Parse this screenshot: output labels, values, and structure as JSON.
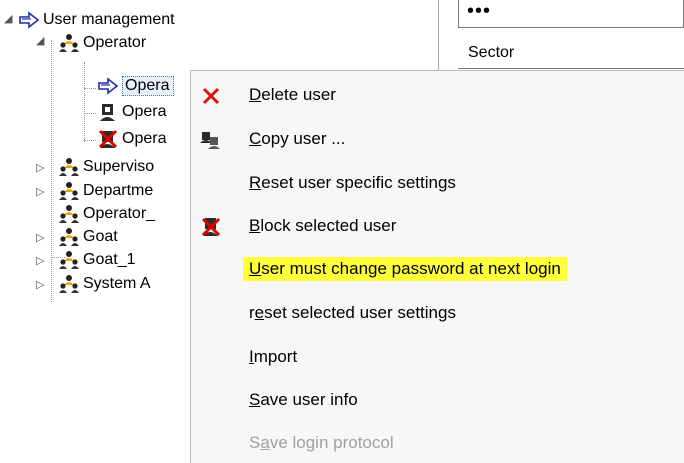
{
  "tree": {
    "root": {
      "label": "User management",
      "icon": "arrow-icon"
    },
    "operator": {
      "label": "Operator"
    },
    "children": [
      {
        "label": "Opera",
        "icon": "arrow-user-icon"
      },
      {
        "label": "Opera",
        "icon": "person-icon"
      },
      {
        "label": "Opera",
        "icon": "blocked-user-icon"
      }
    ],
    "groups": [
      {
        "label": "Superviso",
        "expander": "▷"
      },
      {
        "label": "Departme",
        "expander": "▷"
      },
      {
        "label": "Operator_",
        "expander": ""
      },
      {
        "label": "Goat",
        "expander": "▷"
      },
      {
        "label": "Goat_1",
        "expander": "▷"
      },
      {
        "label": "System A",
        "expander": "▷"
      }
    ]
  },
  "form": {
    "password_mask": "•••",
    "sector_label": "Sector"
  },
  "context_menu": {
    "items": [
      {
        "pre": "",
        "u": "D",
        "post": "elete user",
        "icon": "red-x-icon",
        "state": "normal"
      },
      {
        "pre": "",
        "u": "C",
        "post": "opy user ...",
        "icon": "copy-user-icon",
        "state": "normal"
      },
      {
        "pre": "",
        "u": "R",
        "post": "eset user specific settings",
        "icon": "",
        "state": "normal"
      },
      {
        "pre": "",
        "u": "B",
        "post": "lock selected user",
        "icon": "blocked-user-icon",
        "state": "normal"
      },
      {
        "pre": "",
        "u": "U",
        "post": "ser must change password at next login",
        "icon": "",
        "state": "highlighted"
      },
      {
        "pre": "r",
        "u": "e",
        "post": "set selected user settings",
        "icon": "",
        "state": "normal"
      },
      {
        "pre": "",
        "u": "I",
        "post": "mport",
        "icon": "",
        "state": "normal"
      },
      {
        "pre": "",
        "u": "S",
        "post": "ave user info",
        "icon": "",
        "state": "normal"
      },
      {
        "pre": "S",
        "u": "a",
        "post": "ve login protocol",
        "icon": "",
        "state": "disabled"
      }
    ],
    "highlight_color": "#ffff3a"
  }
}
